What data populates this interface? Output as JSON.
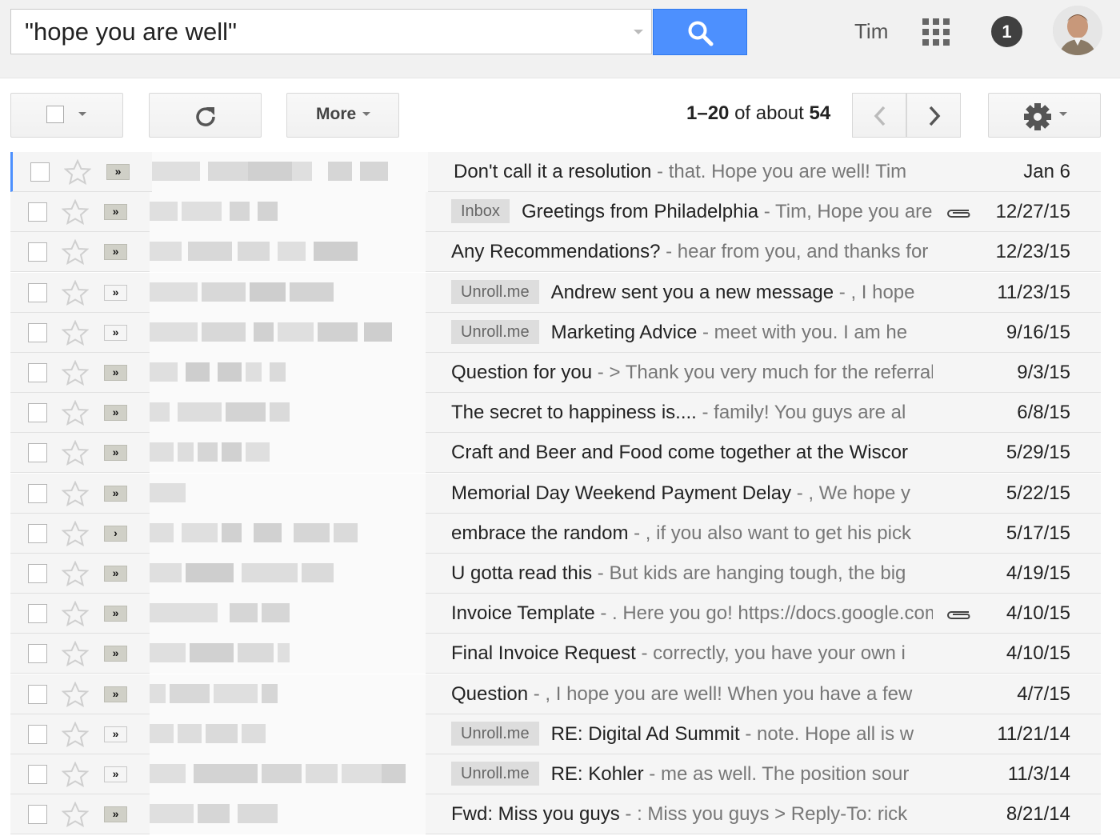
{
  "search": {
    "query": "\"hope you are well\""
  },
  "header": {
    "user_name": "Tim",
    "notification_count": "1"
  },
  "toolbar": {
    "more_label": "More",
    "range": "1–20",
    "of_about": "of about",
    "total": "54"
  },
  "colors": {
    "accent": "#4d90fe",
    "row_bg": "#f5f5f5",
    "label_bg": "#dddddd"
  },
  "emails": [
    {
      "label": "",
      "subject": "Don't call it a resolution",
      "snippet": " - that. Hope you are well! Tim",
      "date": "Jan 6",
      "attachment": false,
      "importance": "filled-double"
    },
    {
      "label": "Inbox",
      "subject": "Greetings from Philadelphia",
      "snippet": " - Tim, Hope you are",
      "date": "12/27/15",
      "attachment": true,
      "importance": "filled-double"
    },
    {
      "label": "",
      "subject": "Any Recommendations?",
      "snippet": " - hear from you, and thanks for",
      "date": "12/23/15",
      "attachment": false,
      "importance": "filled-double"
    },
    {
      "label": "Unroll.me",
      "subject": "Andrew sent you a new message",
      "snippet": " - , I hope",
      "date": "11/23/15",
      "attachment": false,
      "importance": "outline-double"
    },
    {
      "label": "Unroll.me",
      "subject": "Marketing Advice",
      "snippet": " - meet with you. I am he",
      "date": "9/16/15",
      "attachment": false,
      "importance": "outline-double"
    },
    {
      "label": "",
      "subject": "Question for you",
      "snippet": " - > Thank you very much for the referral",
      "date": "9/3/15",
      "attachment": false,
      "importance": "filled-double"
    },
    {
      "label": "",
      "subject": "The secret to happiness is....",
      "snippet": " - family! You guys are al",
      "date": "6/8/15",
      "attachment": false,
      "importance": "filled-double"
    },
    {
      "label": "",
      "subject": "Craft and Beer and Food come together at the Wiscor",
      "snippet": "",
      "date": "5/29/15",
      "attachment": false,
      "importance": "filled-double"
    },
    {
      "label": "",
      "subject": "Memorial Day Weekend Payment Delay",
      "snippet": " - , We hope y",
      "date": "5/22/15",
      "attachment": false,
      "importance": "filled-double"
    },
    {
      "label": "",
      "subject": "embrace the random",
      "snippet": " - , if you also want to get his pick",
      "date": "5/17/15",
      "attachment": false,
      "importance": "filled-single"
    },
    {
      "label": "",
      "subject": "U gotta read this",
      "snippet": " - But kids are hanging tough, the big",
      "date": "4/19/15",
      "attachment": false,
      "importance": "filled-double"
    },
    {
      "label": "",
      "subject": "Invoice Template",
      "snippet": " - . Here you go! https://docs.google.com",
      "date": "4/10/15",
      "attachment": true,
      "importance": "filled-double"
    },
    {
      "label": "",
      "subject": "Final Invoice Request",
      "snippet": " - correctly, you have your own i",
      "date": "4/10/15",
      "attachment": false,
      "importance": "filled-double"
    },
    {
      "label": "",
      "subject": "Question",
      "snippet": " - , I hope you are well! When you have a few",
      "date": "4/7/15",
      "attachment": false,
      "importance": "filled-double"
    },
    {
      "label": "Unroll.me",
      "subject": "RE: Digital Ad Summit",
      "snippet": " - note. Hope all is w",
      "date": "11/21/14",
      "attachment": false,
      "importance": "outline-double"
    },
    {
      "label": "Unroll.me",
      "subject": "RE: Kohler",
      "snippet": " - me as well. The position sour",
      "date": "11/3/14",
      "attachment": false,
      "importance": "outline-double"
    },
    {
      "label": "",
      "subject": "Fwd: Miss you guys",
      "snippet": " - : Miss you guys > Reply-To: rick",
      "date": "8/21/14",
      "attachment": false,
      "importance": "filled-double"
    }
  ]
}
